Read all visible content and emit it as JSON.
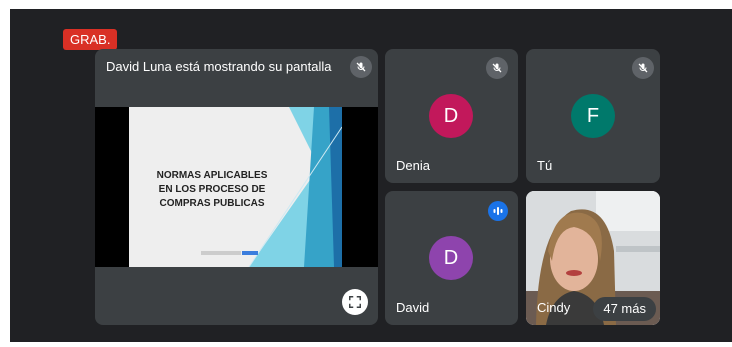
{
  "recording_badge": "GRAB.",
  "presentation": {
    "title": "David Luna está mostrando su pantalla",
    "slide_lines": [
      "NORMAS APLICABLES",
      "EN LOS PROCESO DE",
      "COMPRAS PUBLICAS"
    ]
  },
  "participants": [
    {
      "name": "Denia",
      "initial": "D",
      "color": "#c2185b",
      "muted": true
    },
    {
      "name": "Tú",
      "initial": "F",
      "color": "#00796b",
      "muted": true
    },
    {
      "name": "David",
      "initial": "D",
      "color": "#8e44ad",
      "muted": false,
      "speaking": true
    },
    {
      "name": "Cindy",
      "video": true
    }
  ],
  "more_count": "47 más",
  "icons": {
    "mute": "mic-off-icon",
    "speaking": "audio-wave-icon",
    "fullscreen": "fullscreen-icon"
  }
}
